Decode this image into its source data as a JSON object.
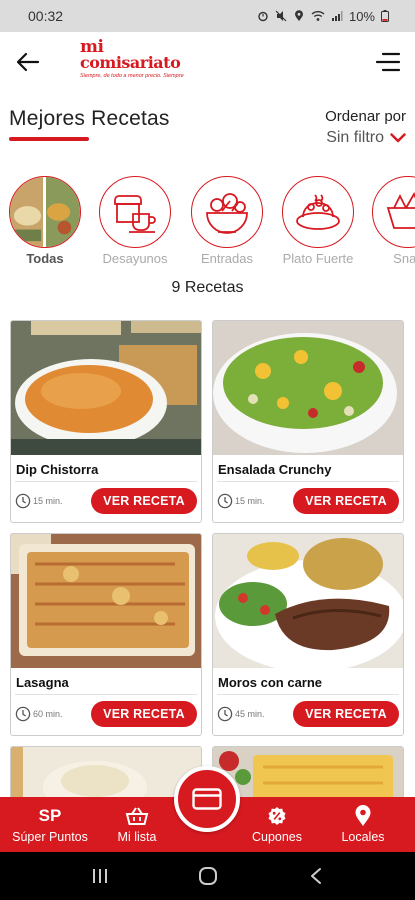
{
  "status_bar": {
    "time": "00:32",
    "battery": "10%"
  },
  "header": {
    "logo_line1": "mi",
    "logo_line2": "comisariato",
    "logo_tagline": "Siempre, de todo a menor precio. Siempre"
  },
  "page": {
    "title": "Mejores Recetas",
    "sort_label": "Ordenar por",
    "sort_value": "Sin filtro",
    "recipe_count": "9 Recetas"
  },
  "categories": [
    {
      "label": "Todas",
      "icon": "all-recipes-photo",
      "active": true
    },
    {
      "label": "Desayunos",
      "icon": "breakfast-icon",
      "active": false
    },
    {
      "label": "Entradas",
      "icon": "salad-bowl-icon",
      "active": false
    },
    {
      "label": "Plato Fuerte",
      "icon": "main-dish-icon",
      "active": false
    },
    {
      "label": "Snac",
      "icon": "snacks-icon",
      "active": false
    }
  ],
  "recipes": [
    {
      "name": "Dip Chistorra",
      "time": "15 min.",
      "button": "VER RECETA"
    },
    {
      "name": "Ensalada Crunchy",
      "time": "15 min.",
      "button": "VER RECETA"
    },
    {
      "name": "Lasagna",
      "time": "60 min.",
      "button": "VER RECETA"
    },
    {
      "name": "Moros con carne",
      "time": "45 min.",
      "button": "VER RECETA"
    }
  ],
  "bottom_nav": {
    "items": [
      {
        "label": "Súper Puntos",
        "icon_text": "SP",
        "icon": "super-points-icon"
      },
      {
        "label": "Mi lista",
        "icon": "basket-icon"
      },
      {
        "label": "Cupones",
        "icon": "coupon-icon"
      },
      {
        "label": "Locales",
        "icon": "location-pin-icon"
      }
    ],
    "fab_icon": "card-icon"
  },
  "colors": {
    "brand": "#d71920",
    "text": "#222222",
    "muted": "#aaaaaa"
  }
}
